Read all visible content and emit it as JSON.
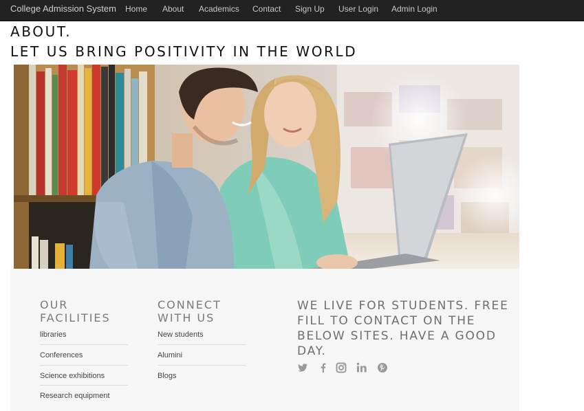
{
  "navbar": {
    "brand": "College Admission System",
    "links": [
      "Home",
      "About",
      "Academics",
      "Contact",
      "Sign Up",
      "User Login",
      "Admin Login"
    ]
  },
  "page": {
    "heading_line1": "ABOUT.",
    "heading_line2": "LET US BRING POSITIVITY IN THE WORLD"
  },
  "hero": {
    "image": "two-students-with-laptop-in-library"
  },
  "footer": {
    "facilities": {
      "title_line1": "OUR",
      "title_line2": "FACILITIES",
      "items": [
        "libraries",
        "Conferences",
        "Science exhibitions",
        "Research equipment"
      ]
    },
    "connect": {
      "title_line1": "CONNECT",
      "title_line2": "WITH US",
      "items": [
        "New students",
        "Alumini",
        "Blogs"
      ]
    },
    "tagline": "WE LIVE FOR STUDENTS. FREE FILL TO CONTACT ON THE BELOW SITES. HAVE A GOOD DAY.",
    "social_icons": [
      "twitter-icon",
      "facebook-icon",
      "instagram-icon",
      "linkedin-icon",
      "pinterest-icon"
    ]
  },
  "colors": {
    "navbar_bg": "#222222",
    "nav_text": "#c8c8c8",
    "footer_bg": "#f6f6f6",
    "footer_title": "#7a7a7a",
    "social_icon": "#9a9a9a"
  }
}
